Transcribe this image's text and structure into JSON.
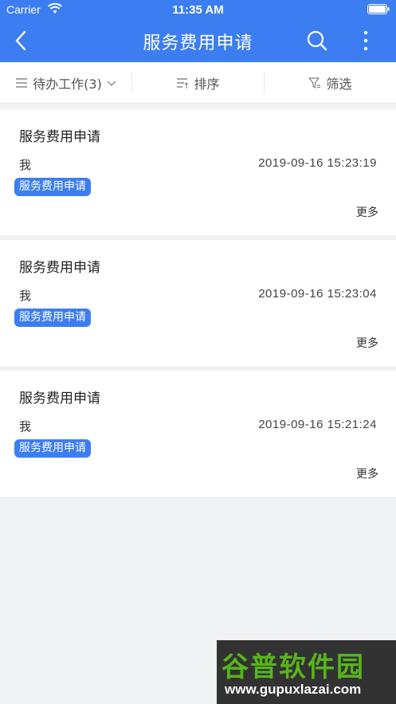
{
  "status_bar": {
    "carrier": "Carrier",
    "time": "11:35 AM"
  },
  "nav": {
    "title": "服务费用申请"
  },
  "filters": [
    {
      "label": "待办工作(3)",
      "icon": "list-icon"
    },
    {
      "label": "排序",
      "icon": "sort-icon"
    },
    {
      "label": "筛选",
      "icon": "filter-icon"
    }
  ],
  "cards": [
    {
      "title": "服务费用申请",
      "user": "我",
      "time": "2019-09-16 15:23:19",
      "tag": "服务费用申请",
      "more": "更多"
    },
    {
      "title": "服务费用申请",
      "user": "我",
      "time": "2019-09-16 15:23:04",
      "tag": "服务费用申请",
      "more": "更多"
    },
    {
      "title": "服务费用申请",
      "user": "我",
      "time": "2019-09-16 15:21:24",
      "tag": "服务费用申请",
      "more": "更多"
    }
  ],
  "watermark": {
    "title": "谷普软件园",
    "url": "www.gupuxlazai.com"
  },
  "colors": {
    "primary": "#3c7ef2",
    "background": "#f1f2f4",
    "watermark_green": "#58b51b"
  }
}
